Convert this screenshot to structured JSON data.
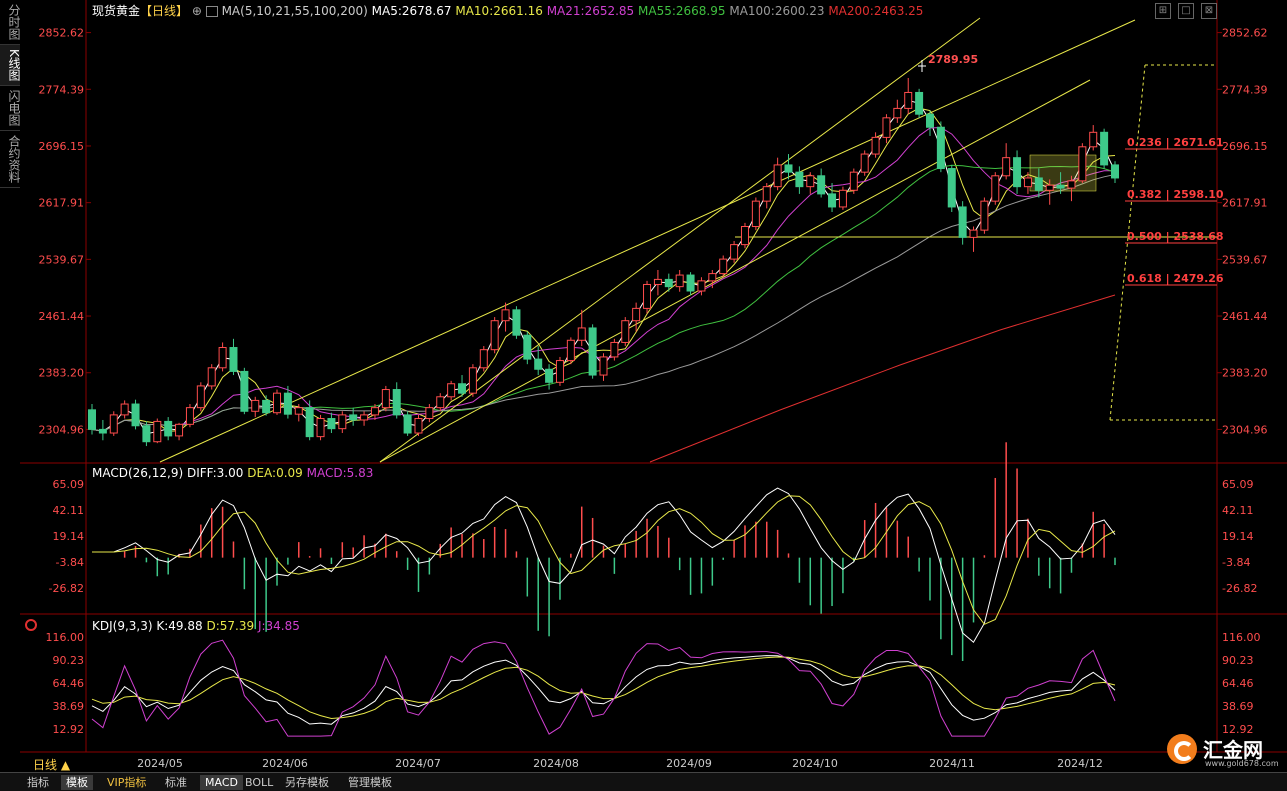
{
  "left_tabs": [
    "分时图",
    "K线图",
    "闪电图",
    "合约资料"
  ],
  "main_header": {
    "symbol": "现货黄金",
    "period": "【日线】",
    "ma_label": "MA(5,10,21,55,100,200)",
    "ma5": "MA5:2678.67",
    "ma10": "MA10:2661.16",
    "ma21": "MA21:2652.85",
    "ma55": "MA55:2668.95",
    "ma100": "MA100:2600.23",
    "ma200": "MA200:2463.25"
  },
  "macd_header": {
    "name": "MACD(26,12,9)",
    "diff": "DIFF:3.00",
    "dea": "DEA:0.09",
    "macd": "MACD:5.83"
  },
  "kdj_header": {
    "name": "KDJ(9,3,3)",
    "k": "K:49.88",
    "d": "D:57.39",
    "j": "J:34.85"
  },
  "price_axis": [
    "2852.62",
    "2774.39",
    "2696.15",
    "2617.91",
    "2539.67",
    "2461.44",
    "2383.20",
    "2304.96"
  ],
  "macd_axis": [
    "65.09",
    "42.11",
    "19.14",
    "-3.84",
    "-26.82"
  ],
  "kdj_axis": [
    "116.00",
    "90.23",
    "64.46",
    "38.69",
    "12.92"
  ],
  "date_axis": [
    "2024/05",
    "2024/06",
    "2024/07",
    "2024/08",
    "2024/09",
    "2024/10",
    "2024/11",
    "2024/12"
  ],
  "annotations": {
    "high_label": "2789.95",
    "fib_236": "0.236 | 2671.61",
    "fib_382": "0.382 | 2598.10",
    "fib_500": "0.500 | 2538.68",
    "fib_618": "0.618 | 2479.26"
  },
  "period_label": "日线 ▲",
  "bottom_tabs": [
    "指标",
    "模板",
    "VIP指标",
    "标准",
    "MACD",
    "BOLL",
    "另存模板",
    "管理模板"
  ],
  "logo": {
    "name": "汇金网",
    "url": "www.gold678.com"
  },
  "colors": {
    "up": "#ff4d4d",
    "down": "#3ec98a",
    "ma5": "#ffffff",
    "ma10": "#e8e84a",
    "ma21": "#d040d0",
    "ma55": "#40c040",
    "ma100": "#9a9a9a",
    "ma200": "#e03030",
    "channel": "#e8e84a"
  },
  "chart_data": {
    "type": "candlestick",
    "title": "现货黄金【日线】",
    "ylim": [
      2260,
      2870
    ],
    "candles": [
      [
        2332,
        2340,
        2298,
        2305
      ],
      [
        2305,
        2318,
        2290,
        2300
      ],
      [
        2300,
        2330,
        2296,
        2325
      ],
      [
        2325,
        2345,
        2320,
        2340
      ],
      [
        2340,
        2346,
        2305,
        2310
      ],
      [
        2310,
        2316,
        2282,
        2288
      ],
      [
        2288,
        2320,
        2286,
        2316
      ],
      [
        2316,
        2322,
        2290,
        2296
      ],
      [
        2296,
        2314,
        2290,
        2312
      ],
      [
        2312,
        2340,
        2308,
        2335
      ],
      [
        2335,
        2370,
        2330,
        2365
      ],
      [
        2365,
        2395,
        2360,
        2390
      ],
      [
        2390,
        2425,
        2385,
        2418
      ],
      [
        2418,
        2430,
        2380,
        2385
      ],
      [
        2385,
        2390,
        2326,
        2330
      ],
      [
        2330,
        2350,
        2322,
        2345
      ],
      [
        2345,
        2352,
        2324,
        2328
      ],
      [
        2328,
        2360,
        2325,
        2355
      ],
      [
        2355,
        2365,
        2320,
        2326
      ],
      [
        2326,
        2340,
        2316,
        2335
      ],
      [
        2335,
        2345,
        2290,
        2295
      ],
      [
        2295,
        2325,
        2290,
        2320
      ],
      [
        2320,
        2328,
        2300,
        2306
      ],
      [
        2306,
        2330,
        2300,
        2325
      ],
      [
        2325,
        2335,
        2310,
        2318
      ],
      [
        2318,
        2330,
        2310,
        2325
      ],
      [
        2325,
        2340,
        2318,
        2335
      ],
      [
        2335,
        2365,
        2330,
        2360
      ],
      [
        2360,
        2370,
        2320,
        2325
      ],
      [
        2325,
        2330,
        2296,
        2300
      ],
      [
        2300,
        2325,
        2296,
        2320
      ],
      [
        2320,
        2340,
        2315,
        2335
      ],
      [
        2335,
        2355,
        2330,
        2350
      ],
      [
        2350,
        2372,
        2345,
        2368
      ],
      [
        2368,
        2380,
        2350,
        2355
      ],
      [
        2355,
        2395,
        2350,
        2390
      ],
      [
        2390,
        2420,
        2385,
        2415
      ],
      [
        2415,
        2460,
        2410,
        2455
      ],
      [
        2455,
        2480,
        2440,
        2470
      ],
      [
        2470,
        2475,
        2430,
        2435
      ],
      [
        2435,
        2440,
        2395,
        2402
      ],
      [
        2402,
        2420,
        2380,
        2388
      ],
      [
        2388,
        2395,
        2360,
        2370
      ],
      [
        2370,
        2405,
        2365,
        2400
      ],
      [
        2400,
        2432,
        2395,
        2428
      ],
      [
        2428,
        2470,
        2420,
        2445
      ],
      [
        2445,
        2450,
        2375,
        2380
      ],
      [
        2380,
        2410,
        2372,
        2405
      ],
      [
        2405,
        2430,
        2400,
        2425
      ],
      [
        2425,
        2460,
        2420,
        2455
      ],
      [
        2455,
        2480,
        2440,
        2472
      ],
      [
        2472,
        2510,
        2465,
        2505
      ],
      [
        2505,
        2525,
        2490,
        2512
      ],
      [
        2512,
        2520,
        2495,
        2502
      ],
      [
        2502,
        2525,
        2495,
        2518
      ],
      [
        2518,
        2522,
        2490,
        2496
      ],
      [
        2496,
        2515,
        2490,
        2510
      ],
      [
        2510,
        2525,
        2500,
        2520
      ],
      [
        2520,
        2545,
        2515,
        2540
      ],
      [
        2540,
        2565,
        2535,
        2560
      ],
      [
        2560,
        2590,
        2555,
        2585
      ],
      [
        2585,
        2625,
        2580,
        2620
      ],
      [
        2620,
        2645,
        2610,
        2640
      ],
      [
        2640,
        2680,
        2635,
        2670
      ],
      [
        2670,
        2685,
        2650,
        2660
      ],
      [
        2660,
        2668,
        2630,
        2640
      ],
      [
        2640,
        2660,
        2630,
        2655
      ],
      [
        2655,
        2665,
        2625,
        2630
      ],
      [
        2630,
        2645,
        2605,
        2612
      ],
      [
        2612,
        2640,
        2608,
        2635
      ],
      [
        2635,
        2665,
        2630,
        2660
      ],
      [
        2660,
        2690,
        2655,
        2685
      ],
      [
        2685,
        2715,
        2680,
        2708
      ],
      [
        2708,
        2740,
        2700,
        2735
      ],
      [
        2735,
        2760,
        2728,
        2748
      ],
      [
        2748,
        2790,
        2740,
        2770
      ],
      [
        2770,
        2775,
        2735,
        2740
      ],
      [
        2740,
        2745,
        2710,
        2722
      ],
      [
        2722,
        2730,
        2660,
        2665
      ],
      [
        2665,
        2670,
        2605,
        2612
      ],
      [
        2612,
        2620,
        2560,
        2570
      ],
      [
        2570,
        2585,
        2550,
        2580
      ],
      [
        2580,
        2625,
        2575,
        2620
      ],
      [
        2620,
        2660,
        2615,
        2655
      ],
      [
        2655,
        2700,
        2650,
        2680
      ],
      [
        2680,
        2690,
        2630,
        2640
      ],
      [
        2640,
        2660,
        2630,
        2652
      ],
      [
        2652,
        2665,
        2625,
        2635
      ],
      [
        2635,
        2650,
        2615,
        2642
      ],
      [
        2642,
        2660,
        2630,
        2638
      ],
      [
        2638,
        2655,
        2620,
        2648
      ],
      [
        2648,
        2700,
        2645,
        2695
      ],
      [
        2695,
        2725,
        2690,
        2715
      ],
      [
        2715,
        2720,
        2665,
        2670
      ],
      [
        2670,
        2675,
        2645,
        2652
      ]
    ]
  }
}
